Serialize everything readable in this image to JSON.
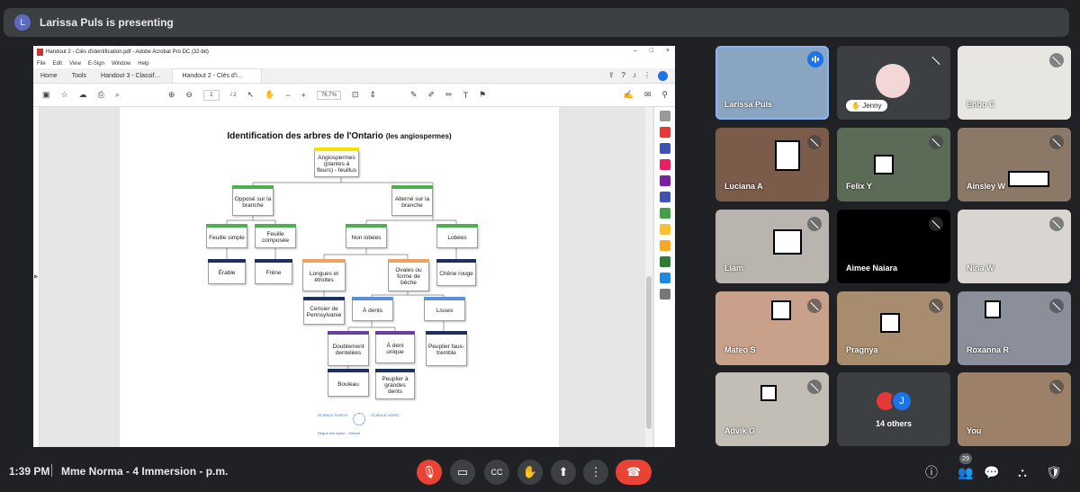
{
  "banner": {
    "avatar_letter": "L",
    "text": "Larissa Puls is presenting"
  },
  "acrobat": {
    "window_title": "Handout 2 - Clés d'identification.pdf - Adobe Acrobat Pro DC (32-bit)",
    "menu": [
      "File",
      "Edit",
      "View",
      "E-Sign",
      "Window",
      "Help"
    ],
    "tabs": {
      "home": "Home",
      "tools": "Tools",
      "doc1": "Handout 3 - Classif...",
      "doc2": "Handout 2 - Clés d'i..."
    },
    "page_current": "2",
    "page_total": "/ 2",
    "zoom": "76.7%"
  },
  "document": {
    "title": "Identification des arbres de l'Ontario",
    "title_note": "(les angiospermes)",
    "nodes": {
      "root": "Angiospermes (plantes à fleurs) - feuillus",
      "oppose": "Opposé sur la branche",
      "alterne": "Alterné sur la branche",
      "simple": "Feuille simple",
      "composee": "Feuille composée",
      "nonlobees": "Non lobées",
      "lobees": "Lobées",
      "erable": "Érable",
      "frene": "Frêne",
      "longues": "Longues et étroites",
      "ovales": "Ovales ou forme de bêche",
      "chene": "Chêne rouge",
      "cerisier": "Cerisier de Pennsylvanie",
      "adents": "À dents",
      "lisses": "Lisses",
      "doublement": "Doublement dentelées",
      "adentunique": "À dent unique",
      "peuplierfaux": "Peuplier faux-tremble",
      "bouleau": "Bouleau",
      "peupliergrandes": "Peuplier à grandes dents"
    },
    "logos": {
      "left": "SCIENCE NORTH",
      "right": "SCIENCE NORD",
      "caption": "Règne des Ayers · Ontario"
    },
    "colors": {
      "yellow": "#f5e400",
      "green": "#4caf50",
      "navy": "#1f2f5f",
      "orange": "#f0a060",
      "blue": "#5c8fd6",
      "purple": "#6a3fa0"
    }
  },
  "participants": [
    {
      "name": "Larissa Puls",
      "speaking": true
    },
    {
      "name": "Jenny"
    },
    {
      "name": "Enbo C"
    },
    {
      "name": "Luciana A"
    },
    {
      "name": "Felix Y"
    },
    {
      "name": "Ainsley W"
    },
    {
      "name": "Liam"
    },
    {
      "name": "Aimee Naiara"
    },
    {
      "name": "Nina W"
    },
    {
      "name": "Mateo S"
    },
    {
      "name": "Pragnya"
    },
    {
      "name": "Roxanna R"
    },
    {
      "name": "Advik G"
    },
    {
      "name": "14 others",
      "avatar_letter": "J"
    },
    {
      "name": "You"
    }
  ],
  "bottom": {
    "time": "1:39 PM",
    "meeting": "Mme Norma - 4 Immersion - p.m.",
    "people_count": "29"
  }
}
